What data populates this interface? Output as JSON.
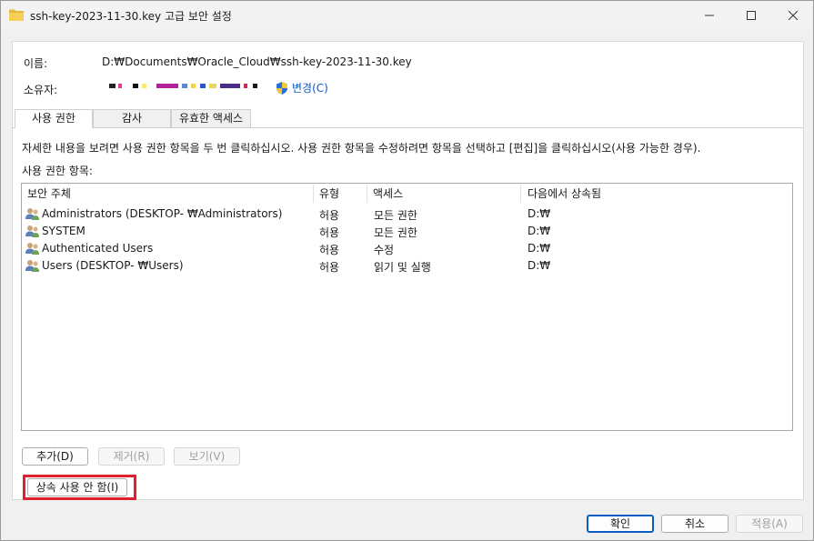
{
  "window": {
    "title": "ssh-key-2023-11-30.key 고급 보안 설정",
    "icon": "folder-icon"
  },
  "fields": {
    "name_label": "이름:",
    "name_value": "D:₩Documents₩Oracle_Cloud₩ssh-key-2023-11-30.key",
    "owner_label": "소유자:",
    "owner_value_redacted": true,
    "change_label": "변경(C)"
  },
  "tabs": [
    {
      "label": "사용 권한",
      "active": true
    },
    {
      "label": "감사",
      "active": false
    },
    {
      "label": "유효한 액세스",
      "active": false
    }
  ],
  "permissions": {
    "instructions": "자세한 내용을 보려면 사용 권한 항목을 두 번 클릭하십시오. 사용 권한 항목을 수정하려면 항목을 선택하고 [편집]을 클릭하십시오(사용 가능한 경우).",
    "entries_label": "사용 권한 항목:",
    "columns": [
      "보안 주체",
      "유형",
      "액세스",
      "다음에서 상속됨"
    ],
    "rows": [
      {
        "principal": "Administrators (DESKTOP-             ₩Administrators)",
        "type": "허용",
        "access": "모든 권한",
        "inherited": "D:₩"
      },
      {
        "principal": "SYSTEM",
        "type": "허용",
        "access": "모든 권한",
        "inherited": "D:₩"
      },
      {
        "principal": "Authenticated Users",
        "type": "허용",
        "access": "수정",
        "inherited": "D:₩"
      },
      {
        "principal": "Users (DESKTOP-             ₩Users)",
        "type": "허용",
        "access": "읽기 및 실행",
        "inherited": "D:₩"
      }
    ]
  },
  "buttons": {
    "add": "추가(D)",
    "remove": "제거(R)",
    "view": "보기(V)",
    "disable_inheritance": "상속 사용 안 함(I)",
    "ok": "확인",
    "cancel": "취소",
    "apply": "적용(A)"
  },
  "colors": {
    "highlight": "#e0202a",
    "link": "#0a5bc4"
  }
}
